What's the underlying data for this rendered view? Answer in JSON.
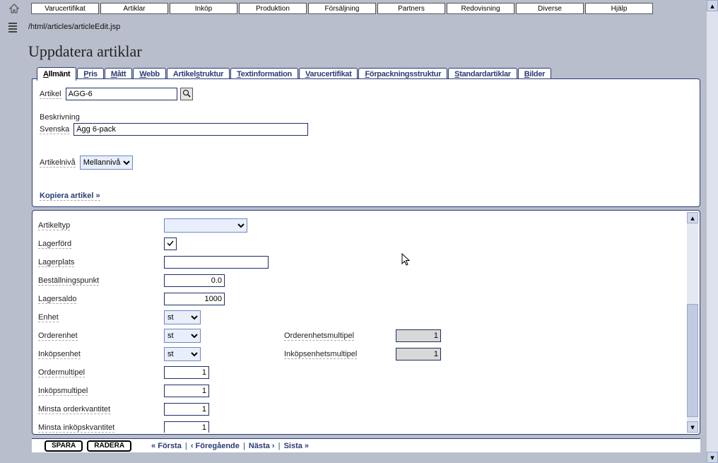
{
  "menu": {
    "items": [
      "Varucertifikat",
      "Artiklar",
      "Inköp",
      "Produktion",
      "Försäljning",
      "Partners",
      "Redovisning",
      "Diverse",
      "Hjälp"
    ]
  },
  "breadcrumb": "/html/articles/articleEdit.jsp",
  "page_title": "Uppdatera artiklar",
  "tabs": [
    {
      "label": "Allmänt",
      "underline": 0
    },
    {
      "label": "Pris",
      "underline": 0
    },
    {
      "label": "Mått",
      "underline": 0
    },
    {
      "label": "Webb",
      "underline": 0
    },
    {
      "label": "Artikelstruktur",
      "underline": 7
    },
    {
      "label": "Textinformation",
      "underline": 0
    },
    {
      "label": "Varucertifikat",
      "underline": 0
    },
    {
      "label": "Förpackningsstruktur",
      "underline": 0
    },
    {
      "label": "Standardartiklar",
      "underline": 0
    },
    {
      "label": "Bilder",
      "underline": 0
    }
  ],
  "panel1": {
    "article_label": "Artikel",
    "article_value": "AGG-6",
    "description_label": "Beskrivning",
    "swedish_label": "Svenska",
    "swedish_value": "Ägg 6-pack",
    "level_label": "Artikelnivå",
    "level_value": "Mellannivå",
    "copy_link": "Kopiera artikel »"
  },
  "panel2": {
    "article_type_label": "Artikeltyp",
    "article_type_value": "",
    "stock_kept_label": "Lagerförd",
    "stock_kept_checked": true,
    "stock_location_label": "Lagerplats",
    "stock_location_value": "",
    "reorder_point_label": "Beställningspunkt",
    "reorder_point_value": "0.0",
    "stock_balance_label": "Lagersaldo",
    "stock_balance_value": "1000",
    "unit_label": "Enhet",
    "unit_value": "st",
    "order_unit_label": "Orderenhet",
    "order_unit_value": "st",
    "order_unit_mult_label": "Orderenhetsmultipel",
    "order_unit_mult_value": "1",
    "purchase_unit_label": "Inköpsenhet",
    "purchase_unit_value": "st",
    "purchase_unit_mult_label": "Inköpsenhetsmultipel",
    "purchase_unit_mult_value": "1",
    "order_mult_label": "Ordermultipel",
    "order_mult_value": "1",
    "purchase_mult_label": "Inköpsmultipel",
    "purchase_mult_value": "1",
    "min_order_qty_label": "Minsta orderkvantitet",
    "min_order_qty_value": "1",
    "min_purchase_qty_label": "Minsta inköpskvantitet",
    "min_purchase_qty_value": "1"
  },
  "footer": {
    "save": "SPARA",
    "delete": "RADERA",
    "first": "« Första",
    "prev": "‹ Föregående",
    "next": "Nästa ›",
    "last": "Sista »"
  }
}
